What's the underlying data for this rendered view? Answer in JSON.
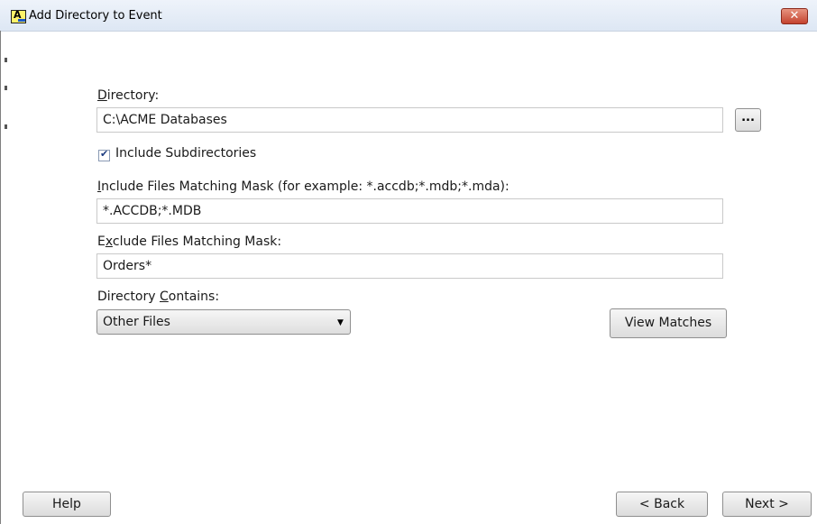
{
  "window": {
    "title": "Add Directory to Event",
    "close_symbol": "✕"
  },
  "directory": {
    "label_key": "D",
    "label_rest": "irectory:",
    "value": "C:\\ACME Databases",
    "browse_label": "..."
  },
  "subdirs": {
    "label": "Include Subdirectories",
    "checked": true
  },
  "include_mask": {
    "label_key": "I",
    "label_rest": "nclude Files Matching Mask (for example: *.accdb;*.mdb;*.mda):",
    "value": "*.ACCDB;*.MDB"
  },
  "exclude_mask": {
    "label_pre": "E",
    "label_key": "x",
    "label_rest": "clude Files Matching Mask:",
    "value": "Orders*"
  },
  "contains": {
    "label_pre": "Directory ",
    "label_key": "C",
    "label_rest": "ontains:",
    "selected": "Other Files"
  },
  "buttons": {
    "view_matches": "View Matches",
    "help": "Help",
    "back": "< Back",
    "next": "Next >"
  },
  "colors": {
    "close": "#c4432f",
    "accent": "#1a59c9"
  }
}
